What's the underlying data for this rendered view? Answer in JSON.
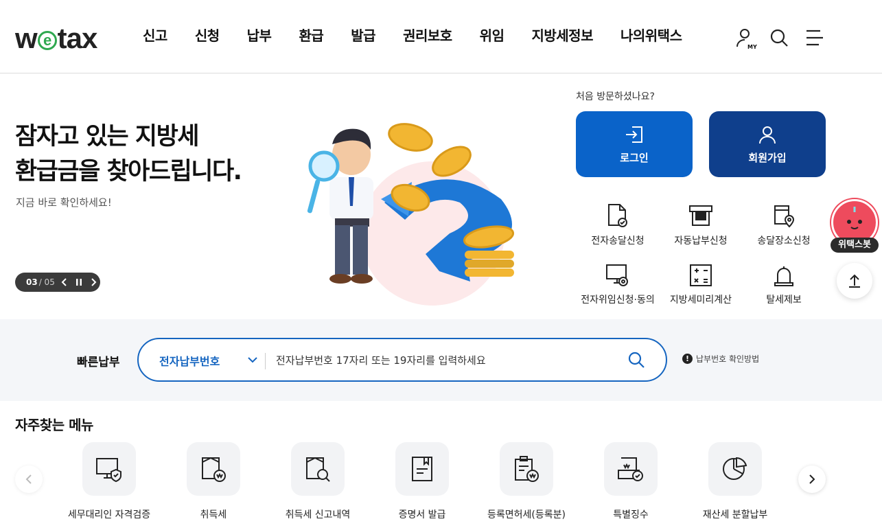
{
  "header": {
    "logo_text": "wetax",
    "nav": [
      "신고",
      "신청",
      "납부",
      "환급",
      "발급",
      "권리보호",
      "위임",
      "지방세정보",
      "나의위택스"
    ],
    "my_tag": "MY",
    "icons": [
      "user-my-icon",
      "search-icon",
      "hamburger-menu-icon"
    ]
  },
  "hero": {
    "title_line1": "잠자고 있는 지방세",
    "title_line2": "환급금을 찾아드립니다.",
    "subtitle": "지금 바로 확인하세요!",
    "slide_current": "03",
    "slide_total": "/ 05"
  },
  "auth": {
    "question": "처음 방문하셨나요?",
    "login_label": "로그인",
    "join_label": "회원가입"
  },
  "quick_links": [
    {
      "label": "전자송달신청",
      "icon": "document-check-icon"
    },
    {
      "label": "자동납부신청",
      "icon": "auto-pay-icon"
    },
    {
      "label": "송달장소신청",
      "icon": "location-document-icon"
    },
    {
      "label": "전자위임신청·동의",
      "icon": "monitor-delegate-icon"
    },
    {
      "label": "지방세미리계산",
      "icon": "calculator-icon"
    },
    {
      "label": "탈세제보",
      "icon": "bell-report-icon"
    }
  ],
  "floating": {
    "chatbot_label": "위택스봇",
    "top_icon": "arrow-up-icon"
  },
  "quick_pay": {
    "title": "빠른납부",
    "select_value": "전자납부번호",
    "placeholder": "전자납부번호 17자리 또는 19자리를 입력하세요",
    "help_text": "납부번호 확인방법"
  },
  "frequent": {
    "title": "자주찾는 메뉴",
    "items": [
      {
        "label": "세무대리인 자격검증",
        "icon": "monitor-shield-icon"
      },
      {
        "label": "취득세",
        "icon": "acquisition-tax-icon"
      },
      {
        "label": "취득세 신고내역",
        "icon": "document-search-icon"
      },
      {
        "label": "증명서 발급",
        "icon": "certificate-icon"
      },
      {
        "label": "등록면허세(등록분)",
        "icon": "clipboard-won-icon"
      },
      {
        "label": "특별징수",
        "icon": "special-collection-icon"
      },
      {
        "label": "재산세 분할납부",
        "icon": "pie-chart-icon"
      }
    ]
  },
  "colors": {
    "primary_blue": "#0a63c9",
    "navy": "#0f3f8c",
    "brand_green": "#2fa84f",
    "chatbot_red": "#ee4b5d"
  }
}
